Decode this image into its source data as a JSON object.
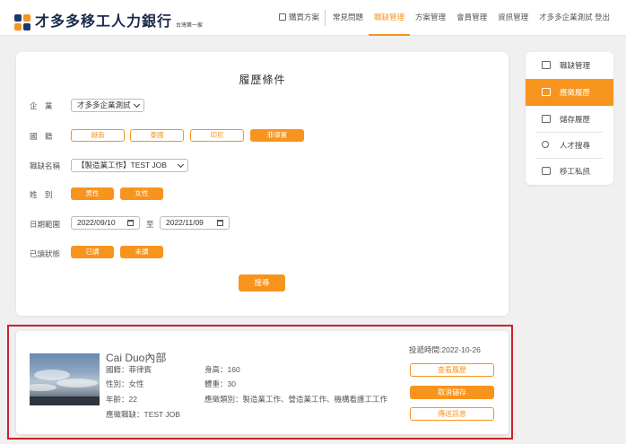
{
  "header": {
    "logo_title": "才多多移工人力銀行",
    "logo_sub": "台灣第一家",
    "nav": [
      "購買方案",
      "常見問題",
      "職缺管理",
      "方案管理",
      "會員管理",
      "資訊管理",
      "才多多企業測試 登出"
    ],
    "active_nav": "職缺管理"
  },
  "filter": {
    "title": "履歷條件",
    "company_label": "企　業",
    "company_value": "才多多企業測試",
    "nationality_label": "國　籍",
    "nationalities": [
      "越南",
      "泰國",
      "印尼",
      "菲律賓"
    ],
    "selected_nationality": "菲律賓",
    "job_label": "職缺名稱",
    "job_value": "【製造業工作】TEST JOB",
    "gender_label": "姓　別",
    "genders": [
      "男性",
      "女性"
    ],
    "date_label": "日期範圍",
    "date_from": "2022/09/10",
    "date_to_label": "至",
    "date_to": "2022/11/09",
    "read_label": "已讀狀態",
    "read_options": [
      "已讀",
      "未讀"
    ],
    "search_label": "搜尋"
  },
  "sidebar": {
    "items": [
      {
        "label": "職缺管理",
        "icon": "briefcase-icon"
      },
      {
        "label": "應徵履歷",
        "icon": "document-icon"
      },
      {
        "label": "儲存履歷",
        "icon": "folder-icon"
      },
      {
        "label": "人才搜尋",
        "icon": "people-search-icon"
      },
      {
        "label": "移工私訊",
        "icon": "chat-icon"
      }
    ],
    "active": "應徵履歷"
  },
  "result": {
    "name": "Cai Duo內部",
    "nationality": "國籍：菲律賓",
    "gender": "性別：女性",
    "age": "年齡：22",
    "job": "應徵職缺：TEST JOB",
    "height": "身高：160",
    "weight": "體重：30",
    "categories": "應徵類別：製造業工作、營造業工作、機構看護工工作",
    "sent_time": "投遞時間:2022-10-26",
    "buttons": [
      "查看履歷",
      "取消儲存",
      "傳送訊息"
    ]
  },
  "colors": {
    "accent": "#f7941d",
    "brand_navy": "#1b3a6b",
    "highlight_border": "#c8232c"
  }
}
